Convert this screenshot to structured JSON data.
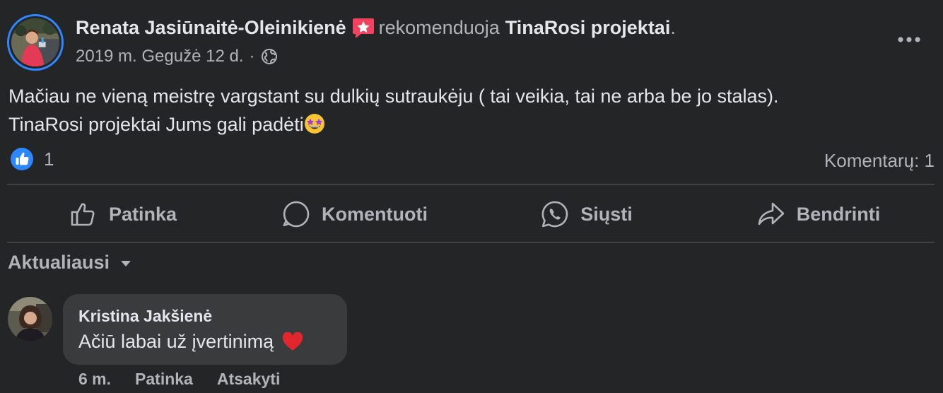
{
  "post": {
    "author": "Renata Jasiūnaitė-Oleinikienė",
    "recommends_text": "rekomenduoja",
    "page_name": "TinaRosi projektai",
    "period": ".",
    "date": "2019 m. Gegužė 12 d.",
    "meta_sep": "·",
    "privacy_icon": "globe-icon",
    "text_line1": "Mačiau ne vieną meistrę vargstant su dulkių sutraukėju ( tai veikia, tai ne arba be jo stalas).",
    "text_line2": "TinaRosi projektai Jums gali padėti",
    "emoji": "star-struck-emoji"
  },
  "reactions": {
    "like_count": "1",
    "comments_label": "Komentarų: 1"
  },
  "actions": {
    "like": "Patinka",
    "comment": "Komentuoti",
    "send": "Siųsti",
    "share": "Bendrinti"
  },
  "sort": {
    "label": "Aktualiausi"
  },
  "comment": {
    "author": "Kristina Jakšienė",
    "text": "Ačiū labai už įvertinimą",
    "emoji": "red-heart-emoji",
    "time": "6 m.",
    "like": "Patinka",
    "reply": "Atsakyti"
  },
  "colors": {
    "background": "#242526",
    "accent_blue": "#2d88ff",
    "recommend_badge": "#f3425f",
    "bubble": "#3a3b3c"
  }
}
